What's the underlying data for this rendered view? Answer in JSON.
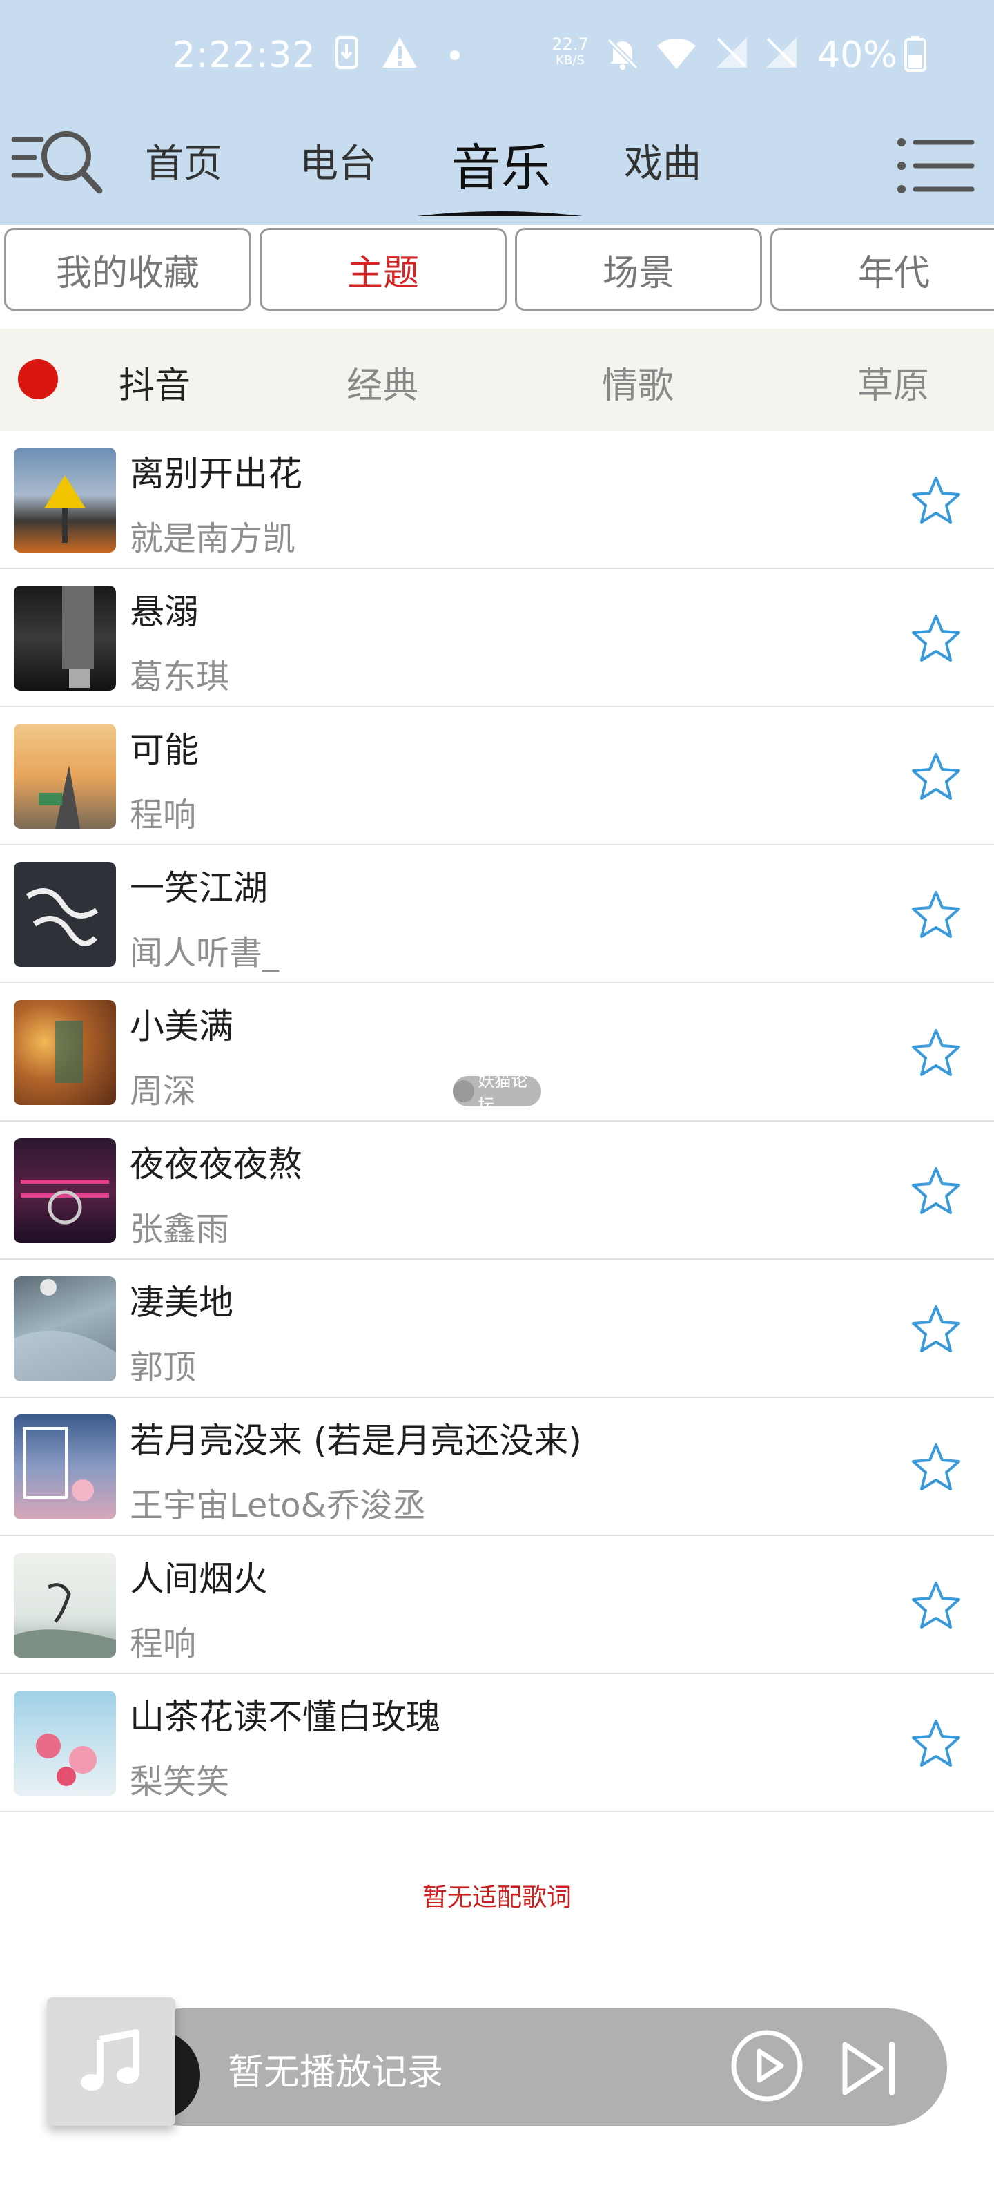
{
  "status_bar": {
    "time": "2:22:32",
    "net_speed_value": "22.7",
    "net_speed_unit": "KB/S",
    "battery": "40%",
    "icons": [
      "download-icon",
      "warning-icon",
      "dot-icon",
      "mute-icon",
      "wifi-icon",
      "no-signal-icon",
      "no-signal-icon",
      "battery-icon"
    ]
  },
  "nav": {
    "tabs": [
      {
        "label": "首页"
      },
      {
        "label": "电台"
      },
      {
        "label": "音乐"
      },
      {
        "label": "戏曲"
      }
    ],
    "active_tab": "音乐"
  },
  "categories": [
    {
      "label": "我的收藏"
    },
    {
      "label": "主题"
    },
    {
      "label": "场景"
    },
    {
      "label": "年代"
    }
  ],
  "subtabs": [
    {
      "label": "抖音"
    },
    {
      "label": "经典"
    },
    {
      "label": "情歌"
    },
    {
      "label": "草原"
    }
  ],
  "songs": [
    {
      "title": "离别开出花",
      "artist": "就是南方凯"
    },
    {
      "title": "悬溺",
      "artist": "葛东琪"
    },
    {
      "title": "可能",
      "artist": "程响"
    },
    {
      "title": "一笑江湖",
      "artist": "闻人听書_"
    },
    {
      "title": "小美满",
      "artist": "周深"
    },
    {
      "title": "夜夜夜夜熬",
      "artist": "张鑫雨"
    },
    {
      "title": "凄美地",
      "artist": "郭顶"
    },
    {
      "title": "若月亮没来 (若是月亮还没来)",
      "artist": "王宇宙Leto&乔浚丞"
    },
    {
      "title": "人间烟火",
      "artist": "程响"
    },
    {
      "title": "山茶花读不懂白玫瑰",
      "artist": "梨笑笑"
    }
  ],
  "watermark": "妖猫论坛",
  "lyric_note": "暂无适配歌词",
  "player": {
    "text": "暂无播放记录"
  },
  "colors": {
    "topbar": "#c7ddef",
    "accent_red": "#d42424",
    "star_blue": "#3a9ad9"
  }
}
